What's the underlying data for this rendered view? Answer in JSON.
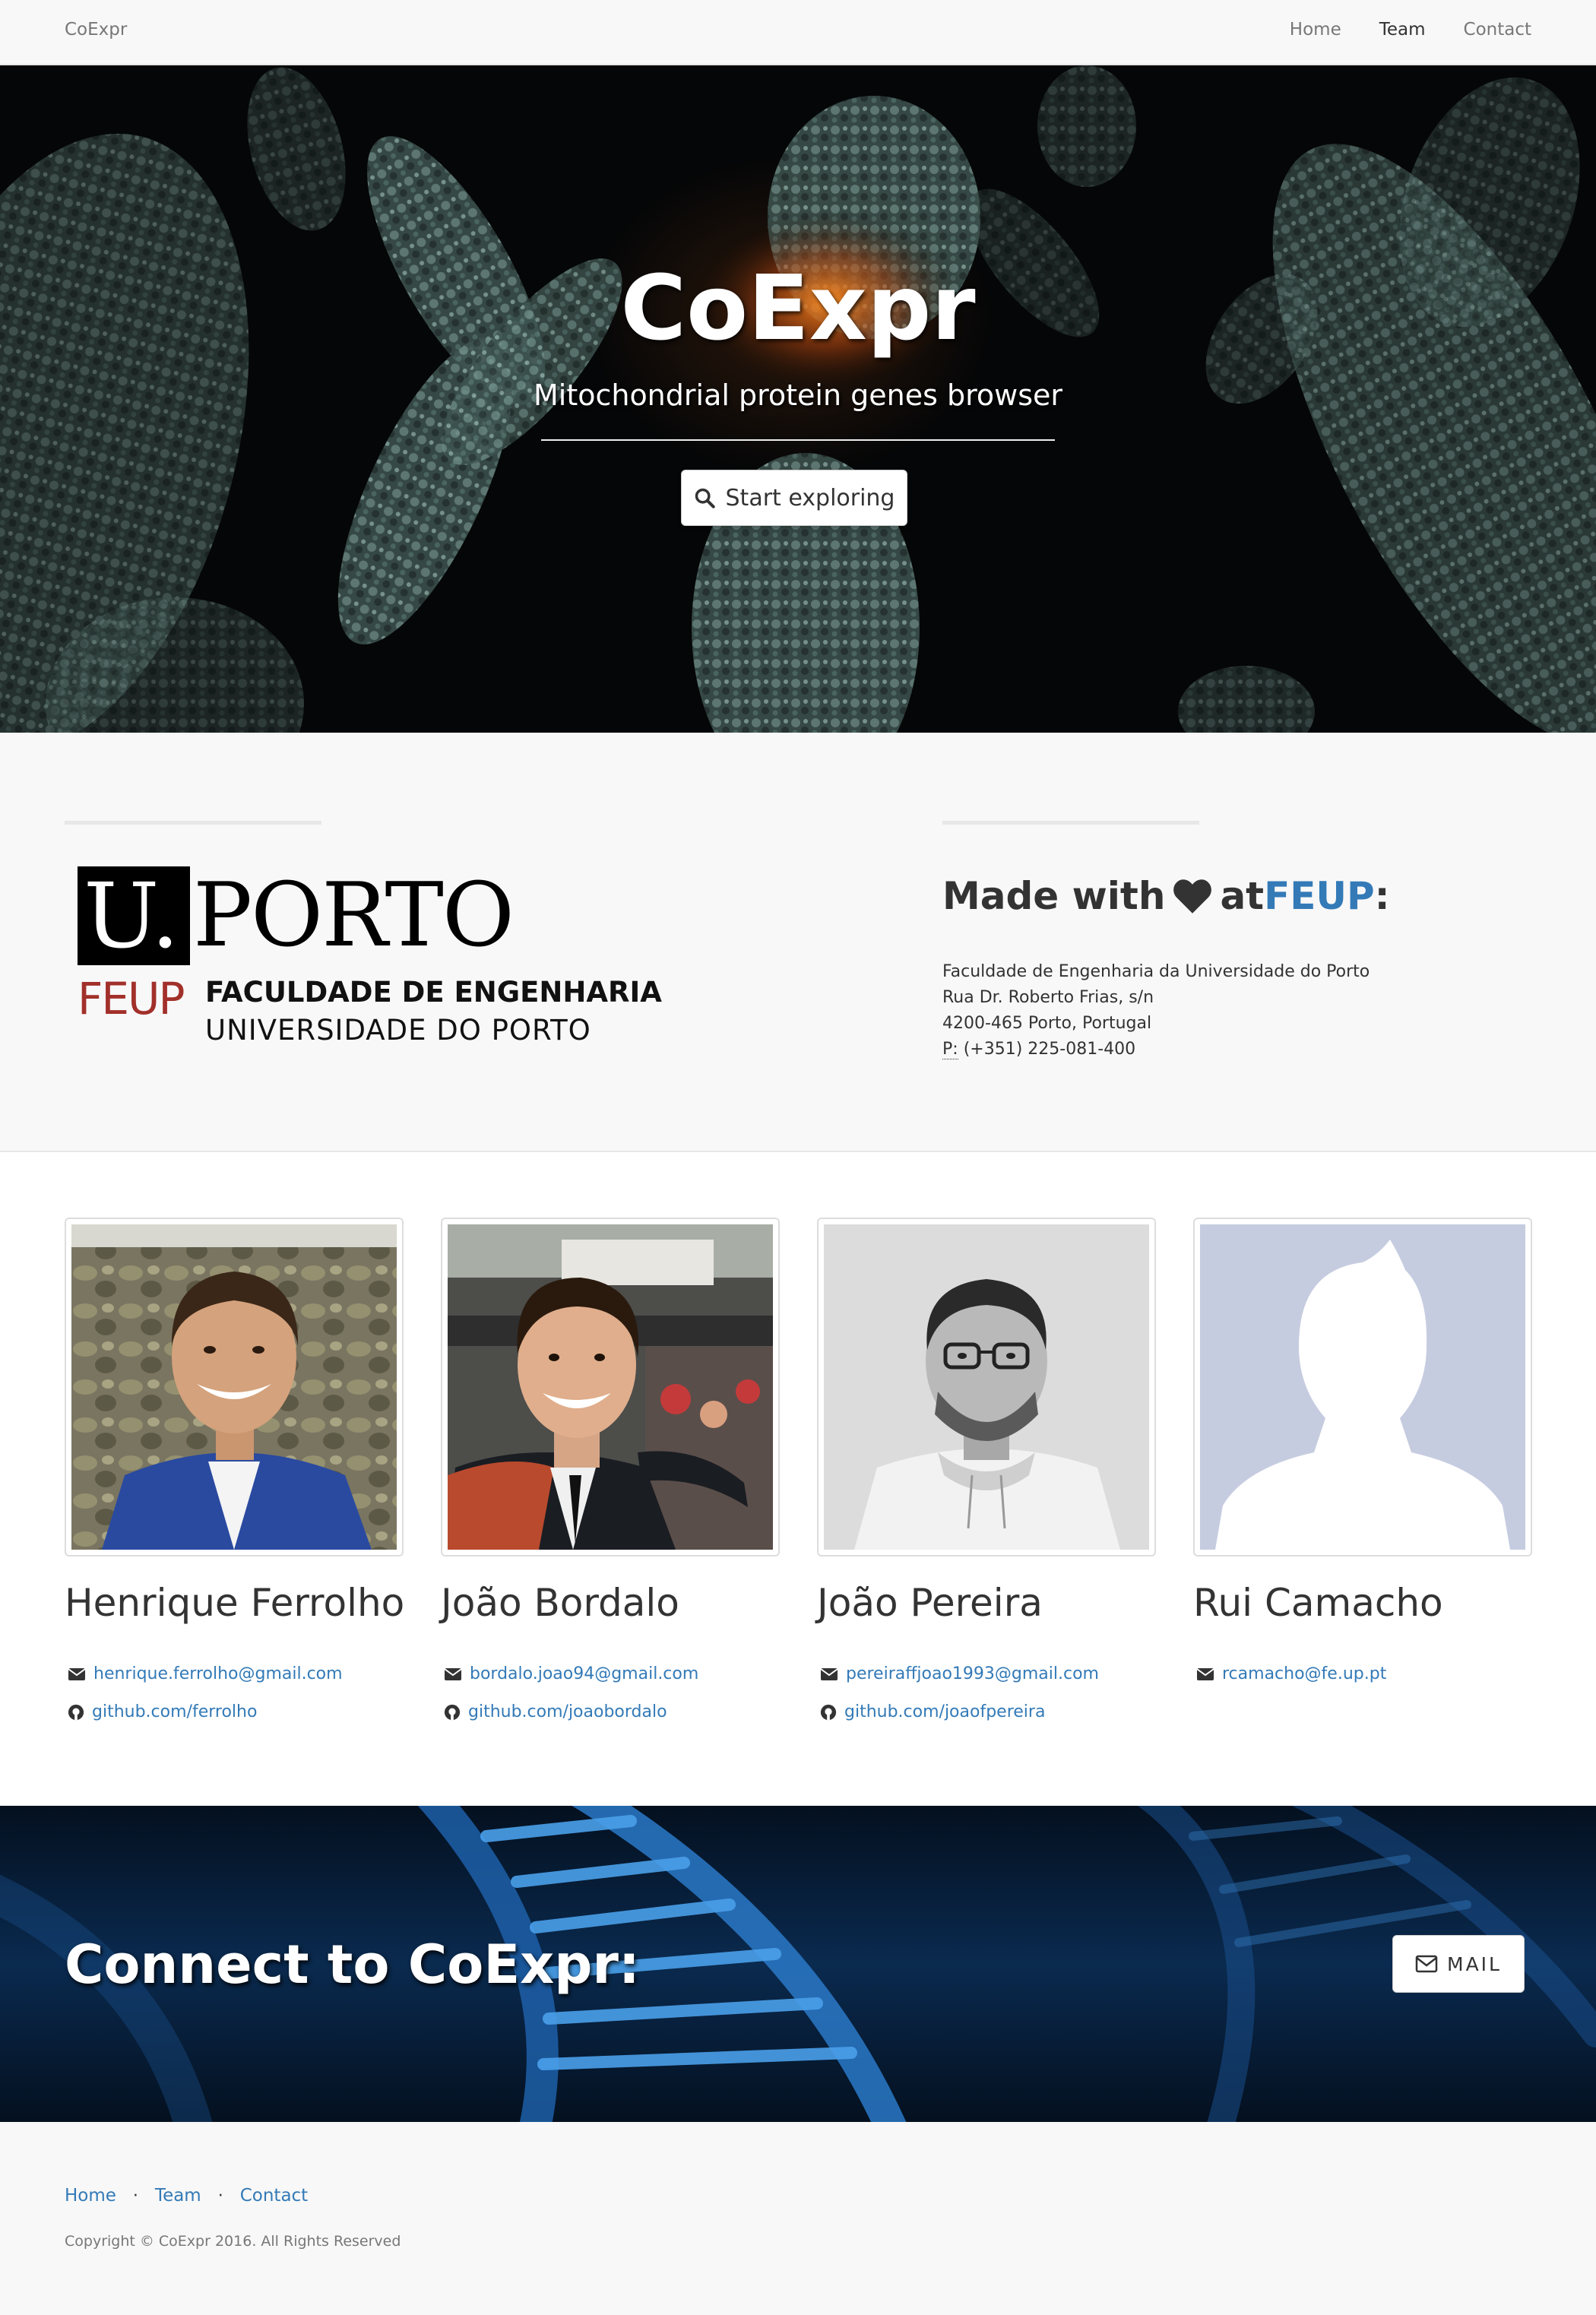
{
  "navbar": {
    "brand": "CoExpr",
    "items": [
      {
        "label": "Home",
        "active": false
      },
      {
        "label": "Team",
        "active": true
      },
      {
        "label": "Contact",
        "active": false
      }
    ]
  },
  "hero": {
    "title": "CoExpr",
    "subtitle": "Mitochondrial protein genes browser",
    "button_label": "Start exploring",
    "button_icon": "search-icon"
  },
  "about": {
    "logo": {
      "u": "U.",
      "porto": "PORTO",
      "feup": "FEUP",
      "faculty": "FACULDADE DE ENGENHARIA",
      "university": "UNIVERSIDADE DO PORTO"
    },
    "made_with": "Made with",
    "made_at": "at",
    "made_feup": "FEUP",
    "made_colon": ":",
    "address": {
      "line1": "Faculdade de Engenharia da Universidade do Porto",
      "line2": "Rua Dr. Roberto Frias, s/n",
      "line3": "4200-465 Porto, Portugal",
      "phone_abbr": "P:",
      "phone": "(+351) 225-081-400"
    }
  },
  "team": [
    {
      "name": "Henrique Ferrolho",
      "email": "henrique.ferrolho@gmail.com",
      "github": "github.com/ferrolho"
    },
    {
      "name": "João Bordalo",
      "email": "bordalo.joao94@gmail.com",
      "github": "github.com/joaobordalo"
    },
    {
      "name": "João Pereira",
      "email": "pereiraffjoao1993@gmail.com",
      "github": "github.com/joaofpereira"
    },
    {
      "name": "Rui Camacho",
      "email": "rcamacho@fe.up.pt",
      "github": ""
    }
  ],
  "connect": {
    "title": "Connect to CoExpr:",
    "mail_label": "MAIL"
  },
  "footer": {
    "links": [
      "Home",
      "Team",
      "Contact"
    ],
    "separator": "·",
    "copyright": "Copyright © CoExpr 2016. All Rights Reserved"
  },
  "colors": {
    "link": "#337ab7",
    "feup_red": "#a2302a",
    "navbar_bg": "#f8f8f8"
  }
}
